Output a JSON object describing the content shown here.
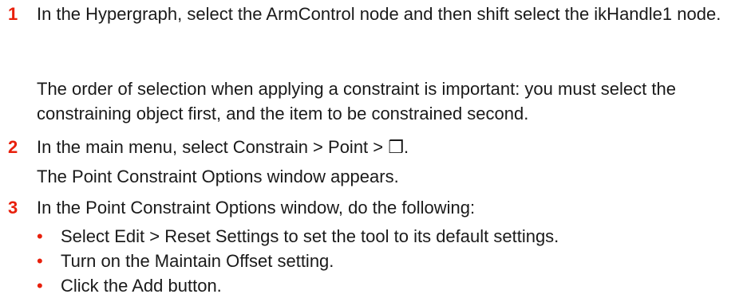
{
  "steps": [
    {
      "number": "1",
      "text": "In the Hypergraph, select the ArmControl node and then shift select the ikHandle1 node.",
      "note": "The order of selection when applying a constraint is important: you must select the constraining object first, and the item to be constrained second."
    },
    {
      "number": "2",
      "text": "In the main menu, select Constrain > Point > ❒.",
      "note": "The Point Constraint Options window appears."
    },
    {
      "number": "3",
      "text": "In the Point Constraint Options window, do the following:",
      "bullets": [
        "Select Edit > Reset Settings to set the tool to its default settings.",
        "Turn on the Maintain Offset setting.",
        "Click the Add button."
      ]
    }
  ],
  "colors": {
    "accent": "#e8200c",
    "text": "#1a1a1a"
  }
}
